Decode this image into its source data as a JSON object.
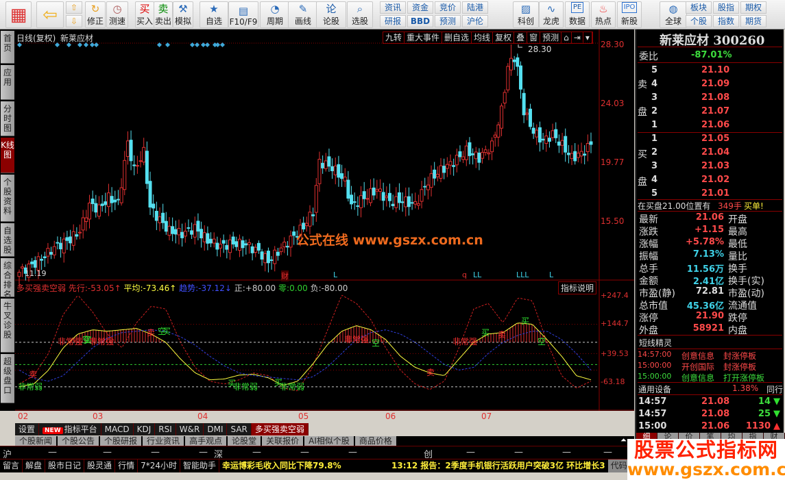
{
  "toolbar": {
    "buttons": [
      {
        "label": "",
        "icon": "windows-grid-icon"
      },
      {
        "label": "",
        "icon": "back-arrow-icon"
      },
      {
        "label": "修正",
        "icon": "refresh-icon"
      },
      {
        "label": "测速",
        "icon": "clock-icon"
      },
      {
        "label": "买入",
        "icon": "buy-icon",
        "glyph": "买"
      },
      {
        "label": "卖出",
        "icon": "sell-icon",
        "glyph": "卖"
      },
      {
        "label": "模拟",
        "icon": "gavel-icon"
      },
      {
        "label": "自选",
        "icon": "star-folder-icon"
      },
      {
        "label": "F10/F9",
        "icon": "document-icon"
      },
      {
        "label": "周期",
        "icon": "period-clock-icon"
      },
      {
        "label": "画线",
        "icon": "pencil-icon"
      },
      {
        "label": "论股",
        "icon": "discuss-icon",
        "glyph": "论"
      },
      {
        "label": "选股",
        "icon": "magnifier-chart-icon"
      },
      {
        "label": "科创",
        "icon": "chart-image-icon"
      },
      {
        "label": "龙虎",
        "icon": "dragon-icon"
      },
      {
        "label": "数据",
        "icon": "pe-icon",
        "glyph": "PE"
      },
      {
        "label": "热点",
        "icon": "hot-fire-icon"
      },
      {
        "label": "新股",
        "icon": "ipo-icon",
        "glyph": "IPO"
      },
      {
        "label": "全球",
        "icon": "globe-icon"
      }
    ],
    "small_buttons": [
      {
        "top": "资讯",
        "bottom": "研报"
      },
      {
        "top": "资金",
        "bottom": "BBD"
      },
      {
        "top": "竞价",
        "bottom": "预测"
      },
      {
        "top": "陆港",
        "bottom": "沪伦"
      },
      {
        "top": "板块",
        "bottom": "个股"
      },
      {
        "top": "股指",
        "bottom": "指数"
      },
      {
        "top": "期权",
        "bottom": "期货"
      }
    ],
    "up_icon": "arrow-up-icon",
    "down_icon": "arrow-down-icon"
  },
  "left_tabs": [
    "首页",
    "应用",
    "分时图",
    "K线图",
    "个股资料",
    "自选股",
    "综合排名",
    "牛叉诊股",
    "超级盘口"
  ],
  "chart_header": {
    "title": "日线(复权)",
    "stock": "新莱应材",
    "buttons": [
      "九转",
      "重大事件",
      "删自选",
      "均线",
      "复权",
      "叠",
      "窗",
      "预测"
    ]
  },
  "chart_data": [
    {
      "type": "candlestick",
      "title": "日线(复权) 新莱应材",
      "y_ticks": [
        "28.30",
        "24.03",
        "19.77",
        "15.50"
      ],
      "ylim": [
        11.2,
        28.3
      ],
      "x_ticks": [
        "02",
        "03",
        "04",
        "05",
        "06",
        "07"
      ],
      "max_label": "28.30",
      "min_label": "11.19",
      "price_path": [
        [
          0,
          11.8
        ],
        [
          6,
          12.6
        ],
        [
          11,
          13.6
        ],
        [
          16,
          14.2
        ],
        [
          19,
          14.8
        ],
        [
          22,
          16.7
        ],
        [
          25,
          16.4
        ],
        [
          28,
          17.2
        ],
        [
          31,
          16.8
        ],
        [
          34,
          21.2
        ],
        [
          36,
          19.2
        ],
        [
          39,
          20.5
        ],
        [
          41,
          16.5
        ],
        [
          44,
          15.6
        ],
        [
          47,
          14.8
        ],
        [
          51,
          14.6
        ],
        [
          55,
          15.0
        ],
        [
          59,
          14.1
        ],
        [
          63,
          13.7
        ],
        [
          67,
          13.9
        ],
        [
          71,
          13.8
        ],
        [
          75,
          13.3
        ],
        [
          78,
          12.6
        ],
        [
          81,
          13.3
        ],
        [
          85,
          14.2
        ],
        [
          89,
          15.1
        ],
        [
          92,
          16.2
        ],
        [
          94,
          19.8
        ],
        [
          98,
          19.4
        ],
        [
          102,
          18.4
        ],
        [
          104,
          16.6
        ],
        [
          108,
          17.2
        ],
        [
          112,
          17.8
        ],
        [
          116,
          16.9
        ],
        [
          120,
          17.0
        ],
        [
          124,
          16.7
        ],
        [
          128,
          18.4
        ],
        [
          132,
          19.2
        ],
        [
          136,
          19.8
        ],
        [
          140,
          20.6
        ],
        [
          144,
          20.1
        ],
        [
          148,
          21.0
        ],
        [
          151,
          23.5
        ],
        [
          154,
          28.3
        ],
        [
          156,
          26.5
        ],
        [
          158,
          23.5
        ],
        [
          161,
          22.0
        ],
        [
          164,
          21.3
        ],
        [
          167,
          21.8
        ],
        [
          170,
          21.0
        ],
        [
          173,
          20.1
        ],
        [
          176,
          20.4
        ],
        [
          179,
          21.06
        ]
      ],
      "markers_top": "diamond",
      "event_labels": [
        "财",
        "L",
        "q",
        "LL",
        "LLL",
        "L"
      ],
      "watermark": "公式在线  www.gszx.com.cn"
    },
    {
      "type": "line",
      "title": "多买强卖空弱",
      "y_ticks": [
        "+247.4",
        "+144.7",
        "+39.53",
        "-63.18"
      ],
      "ylim": [
        -100,
        260
      ],
      "reference_lines": [
        80,
        0,
        -80
      ],
      "series": [
        {
          "name": "先行",
          "color": "#d02020",
          "style": "dashed",
          "values": [
            -70,
            -40,
            40,
            180,
            250,
            190,
            110,
            60,
            150,
            210,
            200,
            80,
            -10,
            -60,
            -70,
            -55,
            -30,
            -40,
            -85,
            -95,
            -10,
            120,
            250,
            220,
            160,
            60,
            -20,
            -70,
            -90,
            -60,
            60,
            200,
            220,
            150,
            240,
            230,
            80,
            -40,
            -85,
            -60
          ]
        },
        {
          "name": "平均",
          "color": "#ffff40",
          "style": "solid",
          "values": [
            -80,
            -70,
            -20,
            60,
            110,
            125,
            120,
            125,
            130,
            110,
            80,
            20,
            -30,
            -55,
            -52,
            -38,
            -35,
            -48,
            -75,
            -60,
            0,
            70,
            120,
            140,
            125,
            90,
            30,
            -10,
            -30,
            -40,
            20,
            80,
            110,
            115,
            150,
            145,
            90,
            30,
            -40,
            -55
          ]
        },
        {
          "name": "趋势",
          "color": "#3040e0",
          "style": "dashed",
          "values": [
            -20,
            -50,
            -60,
            -40,
            10,
            60,
            95,
            115,
            120,
            125,
            120,
            100,
            70,
            30,
            -5,
            -30,
            -40,
            -45,
            -50,
            -55,
            -45,
            -10,
            40,
            90,
            115,
            125,
            110,
            80,
            40,
            0,
            -20,
            -10,
            40,
            80,
            105,
            120,
            120,
            90,
            40,
            -20
          ]
        }
      ],
      "bar_labels": [
        "非常强",
        "卖",
        "买",
        "空",
        "强",
        "非常弱",
        "弱"
      ]
    }
  ],
  "indicator_header": {
    "name": "多买强卖空弱",
    "lead_label": "先行:",
    "lead_value": "-53.05↑",
    "avg_label": "平均:",
    "avg_value": "-73.46↑",
    "trend_label": "趋势:",
    "trend_value": "-37.12↓",
    "pos_label": "正:",
    "pos_value": "+80.00",
    "zero_label": "零:",
    "zero_value": "0.00",
    "neg_label": "负:",
    "neg_value": "-80.00",
    "help": "指标说明"
  },
  "indicator_tabs": [
    "设置",
    "指标平台",
    "MACD",
    "KDJ",
    "RSI",
    "W&R",
    "DMI",
    "SAR",
    "多买强卖空弱"
  ],
  "new_badge": "NEW",
  "info_tabs": [
    "个股新闻",
    "个股公告",
    "个股研报",
    "行业资讯",
    "高手观点",
    "论股堂",
    "关联报价",
    "AI相似个股",
    "商品价格"
  ],
  "index_row": {
    "sh": "沪",
    "sz": "深",
    "cy": "创",
    "dash": "—"
  },
  "bottom_bar": {
    "tabs": [
      "留言",
      "解盘",
      "股市日记",
      "股灵通",
      "行情",
      "7*24小时",
      "智能助手"
    ],
    "news1": "幸运博彩毛收入同比下降79.8%",
    "news2": "13:12 报告：2季度手机银行活跃用户突破3亿 环比增长3",
    "code": "代码"
  },
  "quote": {
    "title": "新莱应材 300260",
    "weibi_label": "委比",
    "weibi": "-87.01%",
    "sell_label": [
      "卖",
      "盘"
    ],
    "buy_label": [
      "买",
      "盘"
    ],
    "sell": [
      {
        "n": "5",
        "p": "21.10"
      },
      {
        "n": "4",
        "p": "21.09"
      },
      {
        "n": "3",
        "p": "21.08"
      },
      {
        "n": "2",
        "p": "21.07"
      },
      {
        "n": "1",
        "p": "21.06"
      }
    ],
    "buy": [
      {
        "n": "1",
        "p": "21.05"
      },
      {
        "n": "2",
        "p": "21.04"
      },
      {
        "n": "3",
        "p": "21.03"
      },
      {
        "n": "4",
        "p": "21.02"
      },
      {
        "n": "5",
        "p": "21.01"
      }
    ],
    "notice": {
      "a": "在买盘21.00位置有",
      "b": "349手",
      "c": "买单!"
    },
    "stats": [
      {
        "l": "最新",
        "v": "21.06",
        "c": "red",
        "r": "开盘"
      },
      {
        "l": "涨跌",
        "v": "+1.15",
        "c": "red",
        "r": "最高"
      },
      {
        "l": "涨幅",
        "v": "+5.78%",
        "c": "red",
        "r": "最低"
      },
      {
        "l": "振幅",
        "v": "7.13%",
        "c": "cy",
        "r": "量比"
      },
      {
        "l": "总手",
        "v": "11.56万",
        "c": "cy",
        "r": "换手"
      },
      {
        "l": "金额",
        "v": "2.41亿",
        "c": "cy",
        "r": "换手(实)"
      },
      {
        "l": "市盈(静)",
        "v": "72.81",
        "c": "wh",
        "r": "市盈(动)"
      },
      {
        "l": "总市值",
        "v": "45.36亿",
        "c": "cy",
        "r": "流通值"
      },
      {
        "l": "涨停",
        "v": "21.90",
        "c": "red",
        "r": "跌停"
      },
      {
        "l": "外盘",
        "v": "58921",
        "c": "red",
        "r": "内盘"
      }
    ],
    "sprite_title": "短线精灵",
    "sprite": [
      {
        "t": "14:57:00",
        "a": "创意信息",
        "b": "封涨停板",
        "c": "red"
      },
      {
        "t": "15:00:00",
        "a": "开创国际",
        "b": "封涨停板",
        "c": "red"
      },
      {
        "t": "15:00:00",
        "a": "创意信息",
        "b": "打开涨停板",
        "c": "grn"
      }
    ],
    "industry": "通用设备",
    "industry_pct": "1.38%",
    "industry_tab": "同行",
    "trades": [
      {
        "t": "14:57",
        "p": "21.08",
        "v": "14",
        "dir": "down"
      },
      {
        "t": "14:57",
        "p": "21.08",
        "v": "25",
        "dir": "down"
      },
      {
        "t": "15:00",
        "p": "21.06",
        "v": "1130",
        "dir": "up"
      }
    ],
    "tabs": [
      "细",
      "论",
      "价",
      "笔",
      "均",
      "指",
      "财"
    ]
  },
  "watermark": {
    "title": "股票公式指标网",
    "url": "www.gszx.com.cn"
  },
  "colors": {
    "up": "#e03030",
    "down": "#54e0f0",
    "bg": "#000000",
    "border": "#8b0000"
  }
}
